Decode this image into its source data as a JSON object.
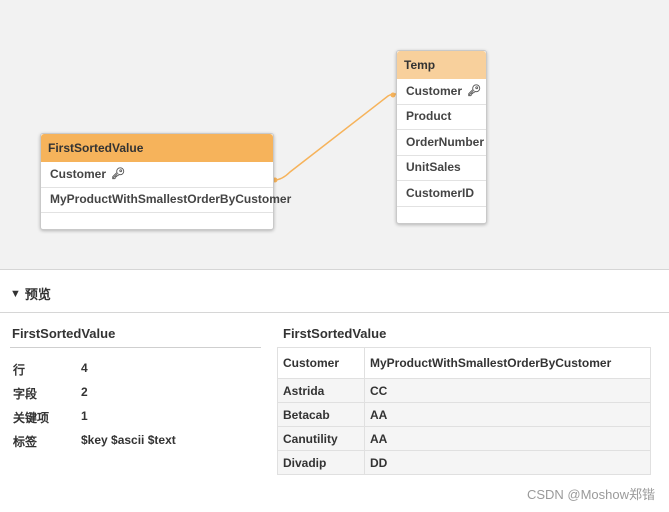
{
  "canvas": {
    "tables": [
      {
        "id": "first",
        "title": "FirstSortedValue",
        "fields": [
          {
            "label": "Customer",
            "key": true
          },
          {
            "label": "MyProductWithSmallestOrderByCustomer",
            "key": false
          }
        ]
      },
      {
        "id": "temp",
        "title": "Temp",
        "fields": [
          {
            "label": "Customer",
            "key": true
          },
          {
            "label": "Product",
            "key": false
          },
          {
            "label": "OrderNumber",
            "key": false
          },
          {
            "label": "UnitSales",
            "key": false
          },
          {
            "label": "CustomerID",
            "key": false
          }
        ]
      }
    ],
    "link_color": "#f6b35b",
    "first_header_color": "#f6b35b",
    "temp_header_color": "#f8d09c",
    "key_icon": "key-icon"
  },
  "preview": {
    "toggle_label": "预览",
    "meta": {
      "title": "FirstSortedValue",
      "rows": [
        {
          "label": "行",
          "value": "4"
        },
        {
          "label": "字段",
          "value": "2"
        },
        {
          "label": "关键项",
          "value": "1"
        },
        {
          "label": "标签",
          "value": "$key $ascii $text"
        }
      ]
    },
    "table": {
      "title": "FirstSortedValue",
      "columns": [
        "Customer",
        "MyProductWithSmallestOrderByCustomer"
      ],
      "rows": [
        [
          "Astrida",
          "CC"
        ],
        [
          "Betacab",
          "AA"
        ],
        [
          "Canutility",
          "AA"
        ],
        [
          "Divadip",
          "DD"
        ]
      ]
    }
  },
  "watermark": "CSDN @Moshow郑锴"
}
